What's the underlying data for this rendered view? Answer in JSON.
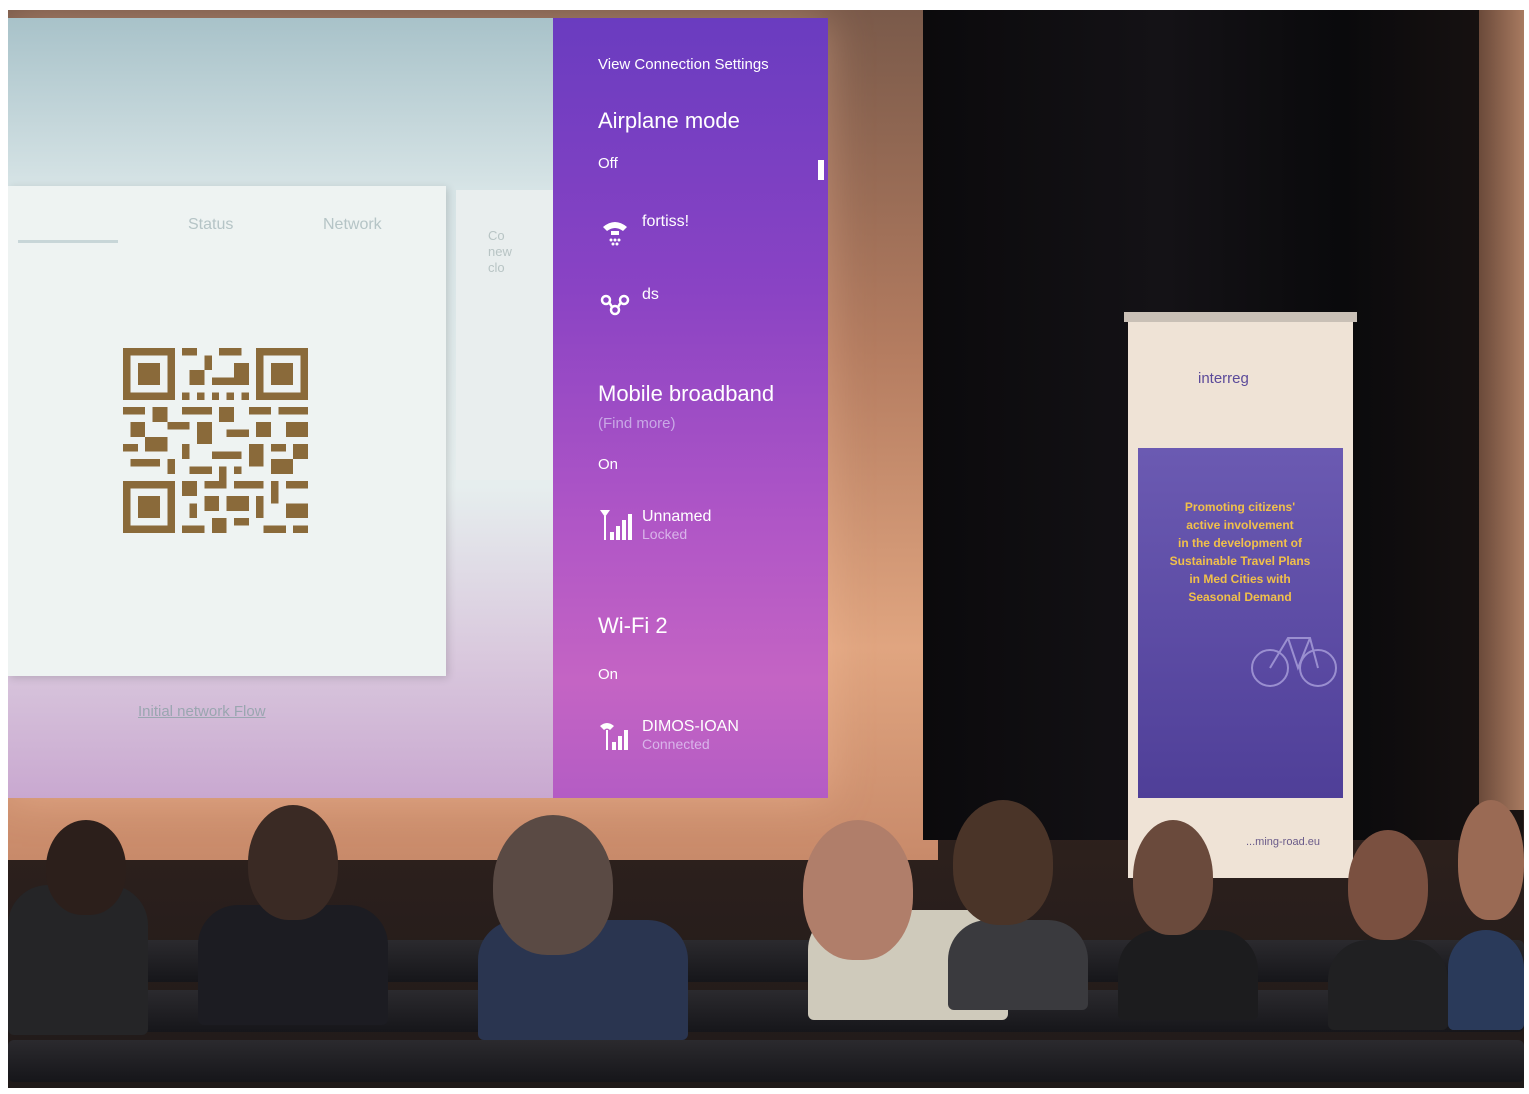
{
  "screen": {
    "app_tabs": [
      "",
      "Status",
      "Network"
    ],
    "side_text": "Co\nnew\nclo",
    "bottom_link": "Initial network Flow"
  },
  "charm": {
    "heading": "View Connection Settings",
    "airplane": {
      "title": "Airplane mode",
      "state": "Off"
    },
    "networks_top": [
      {
        "icon": "dialup-icon",
        "name": "fortiss!"
      },
      {
        "icon": "vpn-icon",
        "name": "ds"
      }
    ],
    "mobile": {
      "title": "Mobile broadband",
      "subtitle": "(Find more)",
      "state": "On",
      "network": {
        "icon": "cellular-signal-icon",
        "name": "Unnamed",
        "status": "Locked"
      }
    },
    "wifi": {
      "title": "Wi-Fi 2",
      "state": "On",
      "network": {
        "icon": "wifi-signal-icon",
        "name": "DIMOS-IOAN",
        "status": "Connected"
      }
    }
  },
  "banner": {
    "logo": "interreg",
    "text_lines": [
      "Promoting citizens'",
      "active involvement",
      "in the development of",
      "Sustainable Travel Plans",
      "in Med Cities with",
      "Seasonal Demand"
    ],
    "footer": "...ming-road.eu"
  },
  "colors": {
    "charm_top": "#6a3cc0",
    "charm_bottom": "#c464c4",
    "qr": "#8a6a3a",
    "banner_purple": "#4f3f98"
  }
}
